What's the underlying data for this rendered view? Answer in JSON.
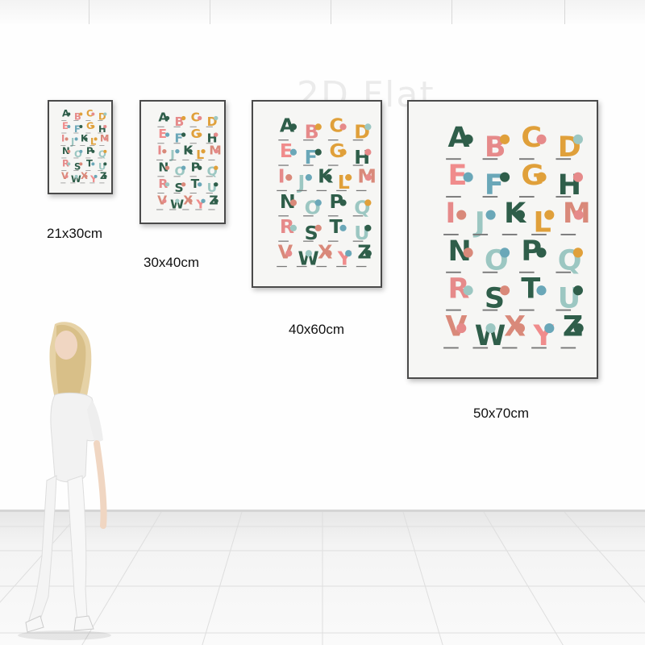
{
  "watermark": "2D Flat",
  "alphabet": [
    "A",
    "B",
    "C",
    "D",
    "E",
    "F",
    "G",
    "H",
    "I",
    "J",
    "K",
    "L",
    "M",
    "N",
    "O",
    "P",
    "Q",
    "R",
    "S",
    "T",
    "U",
    "V",
    "W",
    "X",
    "Y",
    "Z"
  ],
  "letter_colors": [
    "#2f5e4a",
    "#e68a8a",
    "#e0a03a",
    "#e0a03a",
    "#f08c8c",
    "#6aa7b8",
    "#e0a03a",
    "#2f5e4a",
    "#e68a8a",
    "#9cc7c2",
    "#2f5e4a",
    "#e0a03a",
    "#d9897a",
    "#2f5e4a",
    "#9cc7c2",
    "#2f5e4a",
    "#9cc7c2",
    "#e68a8a",
    "#2f5e4a",
    "#2f5e4a",
    "#9cc7c2",
    "#d9897a",
    "#2f5e4a",
    "#d9897a",
    "#f08c8c",
    "#2f5e4a"
  ],
  "posters": [
    {
      "size_label": "21x30cm"
    },
    {
      "size_label": "30x40cm"
    },
    {
      "size_label": "40x60cm"
    },
    {
      "size_label": "50x70cm"
    }
  ],
  "colors": {
    "wall": "#fefefe",
    "floor": "#f2f2f2",
    "frame": "#4a4a4a",
    "poster_bg": "#f6f6f4"
  }
}
